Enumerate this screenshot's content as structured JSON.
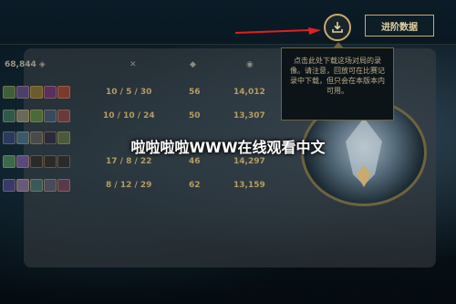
{
  "header": {
    "advanced_label": "进阶数据",
    "download_icon": "download-icon"
  },
  "tooltip": {
    "text": "点击此处下载这场对局的录像。请注意，回放可在比赛记录中下载，但只会在本版本内可用。"
  },
  "stats": {
    "total_gold": "68,844",
    "column_icons": [
      "gold-icon",
      "kda-icon",
      "minion-icon",
      "gold-coin-icon"
    ]
  },
  "rows": [
    {
      "kda": "10 / 5 / 30",
      "cs": "56",
      "gold": "14,012"
    },
    {
      "kda": "10 / 10 / 24",
      "cs": "50",
      "gold": "13,307"
    },
    {
      "kda": "",
      "cs": "",
      "gold": ""
    },
    {
      "kda": "17 / 8 / 22",
      "cs": "46",
      "gold": "14,297"
    },
    {
      "kda": "8 / 12 / 29",
      "cs": "62",
      "gold": "13,159"
    }
  ],
  "watermark": "啦啦啦啦WWW在线观看中文",
  "colors": {
    "accent_gold": "#c8aa6e",
    "panel": "#3c4044",
    "arrow_red": "#e02020"
  }
}
